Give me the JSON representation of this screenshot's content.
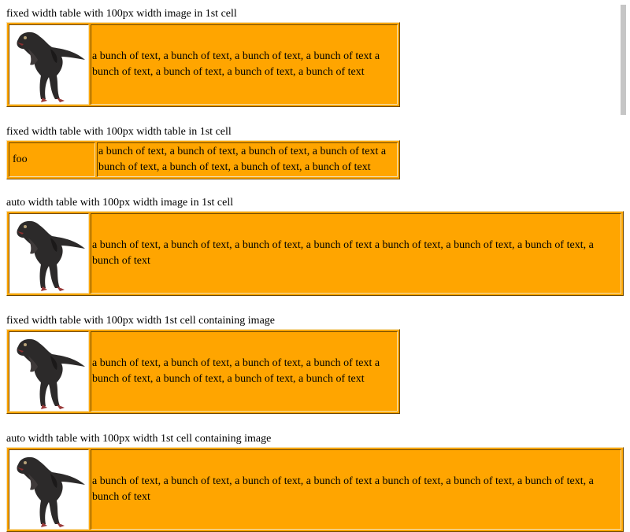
{
  "sections": [
    {
      "caption": "fixed width table with 100px width image in 1st cell",
      "text": "a bunch of text, a bunch of text, a bunch of text, a bunch of text a bunch of text, a bunch of text, a bunch of text, a bunch of text"
    },
    {
      "caption": "fixed width table with 100px width table in 1st cell",
      "cell": "foo",
      "text": "a bunch of text, a bunch of text, a bunch of text, a bunch of text a bunch of text, a bunch of text, a bunch of text, a bunch of text"
    },
    {
      "caption": "auto width table with 100px width image in 1st cell",
      "text": "a bunch of text, a bunch of text, a bunch of text, a bunch of text a bunch of text, a bunch of text, a bunch of text, a bunch of text"
    },
    {
      "caption": "fixed width table with 100px width 1st cell containing image",
      "text": "a bunch of text, a bunch of text, a bunch of text, a bunch of text a bunch of text, a bunch of text, a bunch of text, a bunch of text"
    },
    {
      "caption": "auto width table with 100px width 1st cell containing image",
      "text": "a bunch of text, a bunch of text, a bunch of text, a bunch of text a bunch of text, a bunch of text, a bunch of text, a bunch of text"
    }
  ],
  "colors": {
    "table_bg": "#ffa500",
    "image_bg": "#ffffff",
    "scrollbar": "#c6c6c6"
  },
  "icons": {
    "image": "dinosaur-icon"
  }
}
